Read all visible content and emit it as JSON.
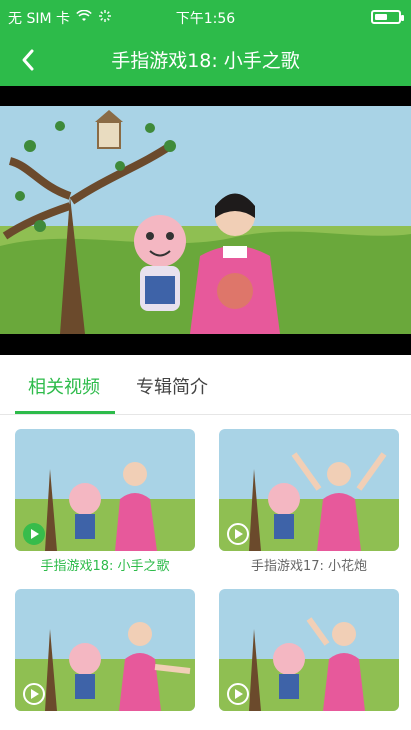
{
  "status": {
    "carrier": "无 SIM 卡",
    "time": "下午1:56",
    "icons": [
      "wifi-icon",
      "signal-loading-icon",
      "battery-icon"
    ]
  },
  "nav": {
    "title": "手指游戏18: 小手之歌",
    "back_icon": "chevron-left-icon",
    "colors": {
      "bar": "#2dbb4a",
      "text": "#ffffff"
    }
  },
  "tabs": [
    {
      "label": "相关视频",
      "active": true
    },
    {
      "label": "专辑简介",
      "active": false
    }
  ],
  "videos": [
    {
      "title": "手指游戏18: 小手之歌",
      "active": true
    },
    {
      "title": "手指游戏17: 小花炮",
      "active": false
    },
    {
      "title": "",
      "active": false
    },
    {
      "title": "",
      "active": false
    }
  ],
  "colors": {
    "accent": "#2dbb4a",
    "muted_text": "#666666"
  }
}
